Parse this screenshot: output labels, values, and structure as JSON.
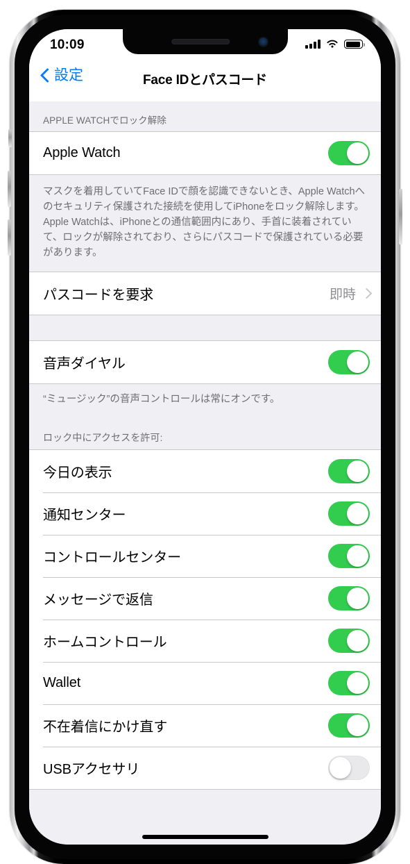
{
  "status_bar": {
    "time": "10:09",
    "signal_icon": "cellular-bars-icon",
    "wifi_icon": "wifi-icon",
    "battery_icon": "battery-icon"
  },
  "nav": {
    "back_label": "設定",
    "back_icon": "chevron-left-icon",
    "title": "Face IDとパスコード"
  },
  "sections": {
    "apple_watch": {
      "header": "APPLE WATCHでロック解除",
      "row_label": "Apple Watch",
      "row_value": "on",
      "footnote": "マスクを着用していてFace IDで顔を認識できないとき、Apple Watchへのセキュリティ保護された接続を使用してiPhoneをロック解除します。Apple Watchは、iPhoneとの通信範囲内にあり、手首に装着されていて、ロックが解除されており、さらにパスコードで保護されている必要があります。"
    },
    "require_passcode": {
      "row_label": "パスコードを要求",
      "row_value": "即時",
      "disclosure_icon": "chevron-right-icon"
    },
    "voice_dial": {
      "row_label": "音声ダイヤル",
      "row_value": "on",
      "footnote": "“ミュージック”の音声コントロールは常にオンです。"
    },
    "allow_access": {
      "header": "ロック中にアクセスを許可:",
      "rows": [
        {
          "label": "今日の表示",
          "value": "on"
        },
        {
          "label": "通知センター",
          "value": "on"
        },
        {
          "label": "コントロールセンター",
          "value": "on"
        },
        {
          "label": "メッセージで返信",
          "value": "on"
        },
        {
          "label": "ホームコントロール",
          "value": "on"
        },
        {
          "label": "Wallet",
          "value": "on"
        },
        {
          "label": "不在着信にかけ直す",
          "value": "on"
        },
        {
          "label": "USBアクセサリ",
          "value": "off"
        }
      ]
    }
  },
  "colors": {
    "accent": "#007aff",
    "toggle_on": "#32cd4f",
    "toggle_off": "#e9e9eb",
    "group_bg": "#efeff4",
    "secondary_text": "#6d6d72"
  }
}
